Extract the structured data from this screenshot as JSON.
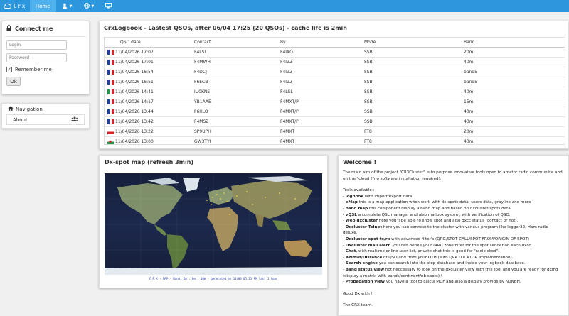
{
  "navbar": {
    "brand": "Crx",
    "home_label": "Home"
  },
  "connect": {
    "title": "Connect me",
    "login_placeholder": "Login",
    "password_placeholder": "Password",
    "remember_label": "Remember me",
    "ok_label": "Ok"
  },
  "navigation": {
    "title": "Navigation",
    "about_label": "About"
  },
  "logbook": {
    "title": "CrxLogbook - Lastest QSOs, after 06/04 17:25 (20 QSOs) - cache life is 2min",
    "columns": [
      "QSO date",
      "Contact",
      "By",
      "Mode",
      "Band"
    ],
    "rows": [
      {
        "flag": "fr",
        "date": "11/04/2026 17:07",
        "contact": "F4LSL",
        "by": "F4IXQ",
        "mode": "SSB",
        "band": "20m"
      },
      {
        "flag": "fr",
        "date": "11/04/2026 17:01",
        "contact": "F4MWH",
        "by": "F4IZZ",
        "mode": "SSB",
        "band": "40m"
      },
      {
        "flag": "fr",
        "date": "11/04/2026 16:54",
        "contact": "F4DCJ",
        "by": "F4IZZ",
        "mode": "SSB",
        "band": "band5"
      },
      {
        "flag": "fr",
        "date": "11/04/2026 16:51",
        "contact": "F6ECB",
        "by": "F4IZZ",
        "mode": "SSB",
        "band": "band5"
      },
      {
        "flag": "it",
        "date": "11/04/2026 14:41",
        "contact": "IU0KNS",
        "by": "F4LSL",
        "mode": "SSB",
        "band": "40m"
      },
      {
        "flag": "fr",
        "date": "11/04/2026 14:17",
        "contact": "YB1AAE",
        "by": "F4MXT/P",
        "mode": "SSB",
        "band": "15m"
      },
      {
        "flag": "fr",
        "date": "11/04/2026 13:44",
        "contact": "F6HLO",
        "by": "F4MXT/P",
        "mode": "SSB",
        "band": "40m"
      },
      {
        "flag": "fr",
        "date": "11/04/2026 13:42",
        "contact": "F4MSZ",
        "by": "F4MXT/P",
        "mode": "SSB",
        "band": "40m"
      },
      {
        "flag": "pl",
        "date": "11/04/2026 13:22",
        "contact": "SP9UPH",
        "by": "F4MXT",
        "mode": "FT8",
        "band": "20m"
      },
      {
        "flag": "wa",
        "date": "11/04/2026 13:00",
        "contact": "GW3TYI",
        "by": "F4MXT",
        "mode": "FT8",
        "band": "40m"
      }
    ]
  },
  "map": {
    "title": "Dx-spot map (refresh 3min)",
    "caption": "C R X - MAP - Band: 2m , 6m , 10m - generated on 11/04 05:25 PM  last 1 hour"
  },
  "welcome": {
    "title": "Welcome !",
    "intro": "The main aim of the project \"CRXCluster\" is to purpose innovative tools open to amator radio communitie and on the \"cloud (\"no software installation required).",
    "tools_title": "Tools available :",
    "tools": [
      {
        "name": "logbook",
        "desc": " with import/export data."
      },
      {
        "name": "eMap",
        "desc": " this is a map application witch work with dx spots data, users data, grayline and more !"
      },
      {
        "name": "band map",
        "desc": " this component display a band map and based on dxcluster-spots data."
      },
      {
        "name": "vQSL",
        "desc": " a complete QSL manager and also mailbox system, with verification of QSO."
      },
      {
        "name": "Web dxcluster",
        "desc": " here you'll be able to show spot and also dxcc status (contact or not)."
      },
      {
        "name": "Dxcluster Telnet",
        "desc": " here you can connect to the cluster with various program like logger32, Ham radio deluxe."
      },
      {
        "name": "Dxcluster spot tx/rx",
        "desc": " with advanced filter's (QRG/SPOT CALL/SPOT FROM/ORIGIN OF SPOT)"
      },
      {
        "name": "Dxcluster mail alert",
        "desc": ", you can define your IARU zone filter for the spot sender on each dxcc."
      },
      {
        "name": "Chat",
        "desc": ", with realtime online user list, private chat this is good for \"radio sked\"."
      },
      {
        "name": "Azimut/Distance",
        "desc": " of QSO and from your QTH (with QRA LOCATOR implementation)."
      },
      {
        "name": "Search engine",
        "desc": " you can search into the stop database and inside your logbook database."
      },
      {
        "name": "Band status view",
        "desc": " not neccessary to look on the dxcluster view with this tool and you are ready for dxing (display a matrix with bands/continent/nb spots) !"
      },
      {
        "name": "Propagation view",
        "desc": " you have a tool to calcul MUF and also a display provide by N0NBH."
      }
    ],
    "closing": "Good Dx with !",
    "signature": "The CRX team."
  }
}
